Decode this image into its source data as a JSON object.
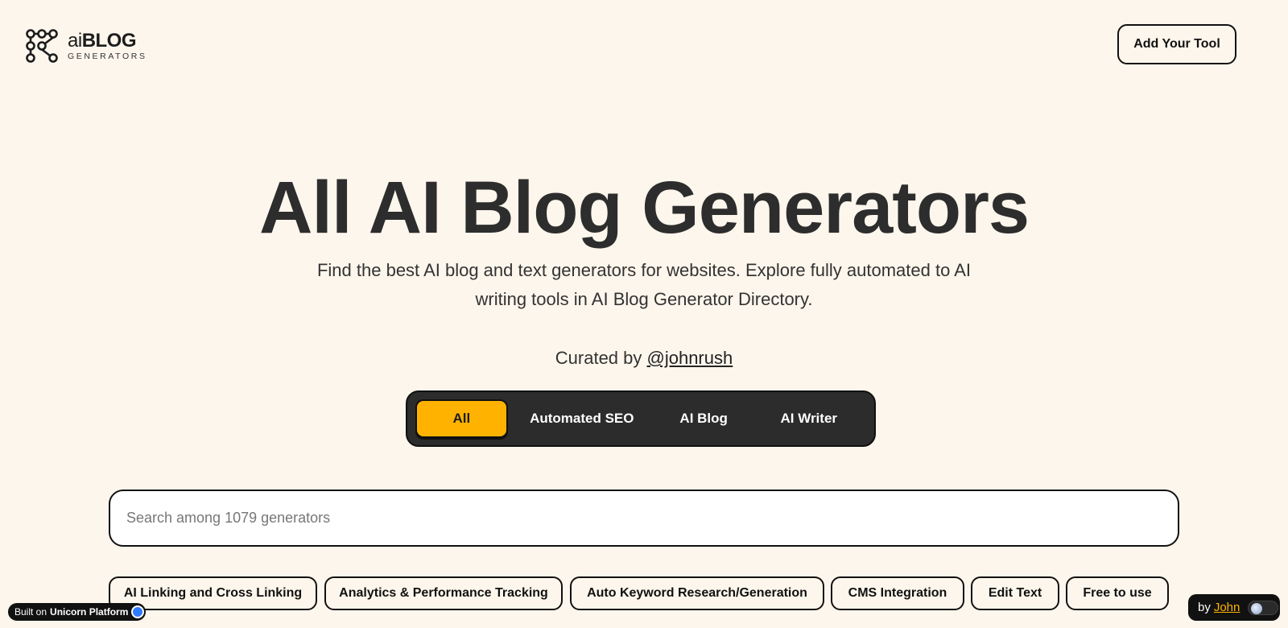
{
  "logo": {
    "main_ai": "ai",
    "main_blog": "BLOG",
    "sub": "GENERATORS"
  },
  "header": {
    "add_tool_label": "Add Your Tool"
  },
  "hero": {
    "title": "All AI Blog Generators",
    "subtitle": "Find the best AI blog and text generators for websites. Explore fully automated to AI writing tools in AI Blog Generator Directory.",
    "curated_prefix": "Curated by ",
    "curated_handle": "@johnrush"
  },
  "tabs": [
    {
      "label": "All",
      "active": true
    },
    {
      "label": "Automated SEO",
      "active": false
    },
    {
      "label": "AI Blog",
      "active": false
    },
    {
      "label": "AI Writer",
      "active": false
    }
  ],
  "search": {
    "placeholder": "Search among 1079 generators",
    "value": ""
  },
  "tags": [
    "AI Linking and Cross Linking",
    "Analytics & Performance Tracking",
    "Auto Keyword Research/Generation",
    "CMS Integration",
    "Edit Text",
    "Free to use"
  ],
  "badges": {
    "built_on_prefix": "Built on ",
    "built_on_platform": "Unicorn Platform",
    "by_prefix": "by ",
    "by_name": "John"
  },
  "colors": {
    "background": "#fdf6ec",
    "accent": "#ffb300",
    "dark": "#2c2c2c"
  }
}
